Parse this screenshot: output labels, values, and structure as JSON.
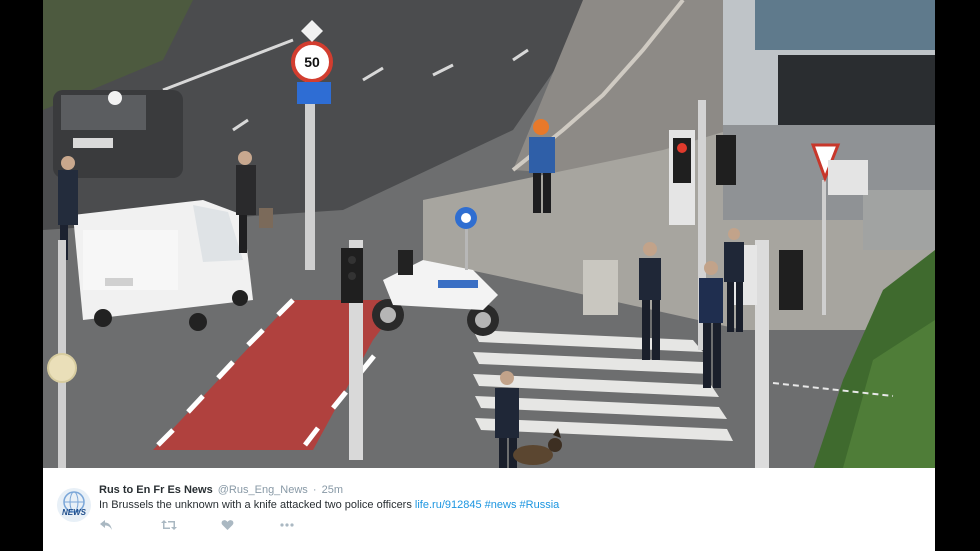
{
  "photo": {
    "speed_sign_value": "50",
    "description_icon": "street-photo"
  },
  "tweet": {
    "avatar_text": "NEWS",
    "display_name": "Rus to En Fr Es News",
    "handle": "@Rus_Eng_News",
    "separator": "·",
    "timestamp": "25m",
    "text_prefix": "In Brussels the unknown with a knife attacked two police officers",
    "link": "life.ru/912845",
    "hashtags": [
      "#news",
      "#Russia"
    ],
    "actions": [
      {
        "icon": "reply-icon"
      },
      {
        "icon": "retweet-icon"
      },
      {
        "icon": "like-icon"
      },
      {
        "icon": "more-icon"
      }
    ]
  },
  "colors": {
    "link": "#1b95e0",
    "name": "#292f33",
    "meta": "#8899a6",
    "action": "#aab8c2",
    "bike_lane": "#b0413e",
    "police_vest": "#2f5fa8",
    "helmet": "#e8792a"
  }
}
